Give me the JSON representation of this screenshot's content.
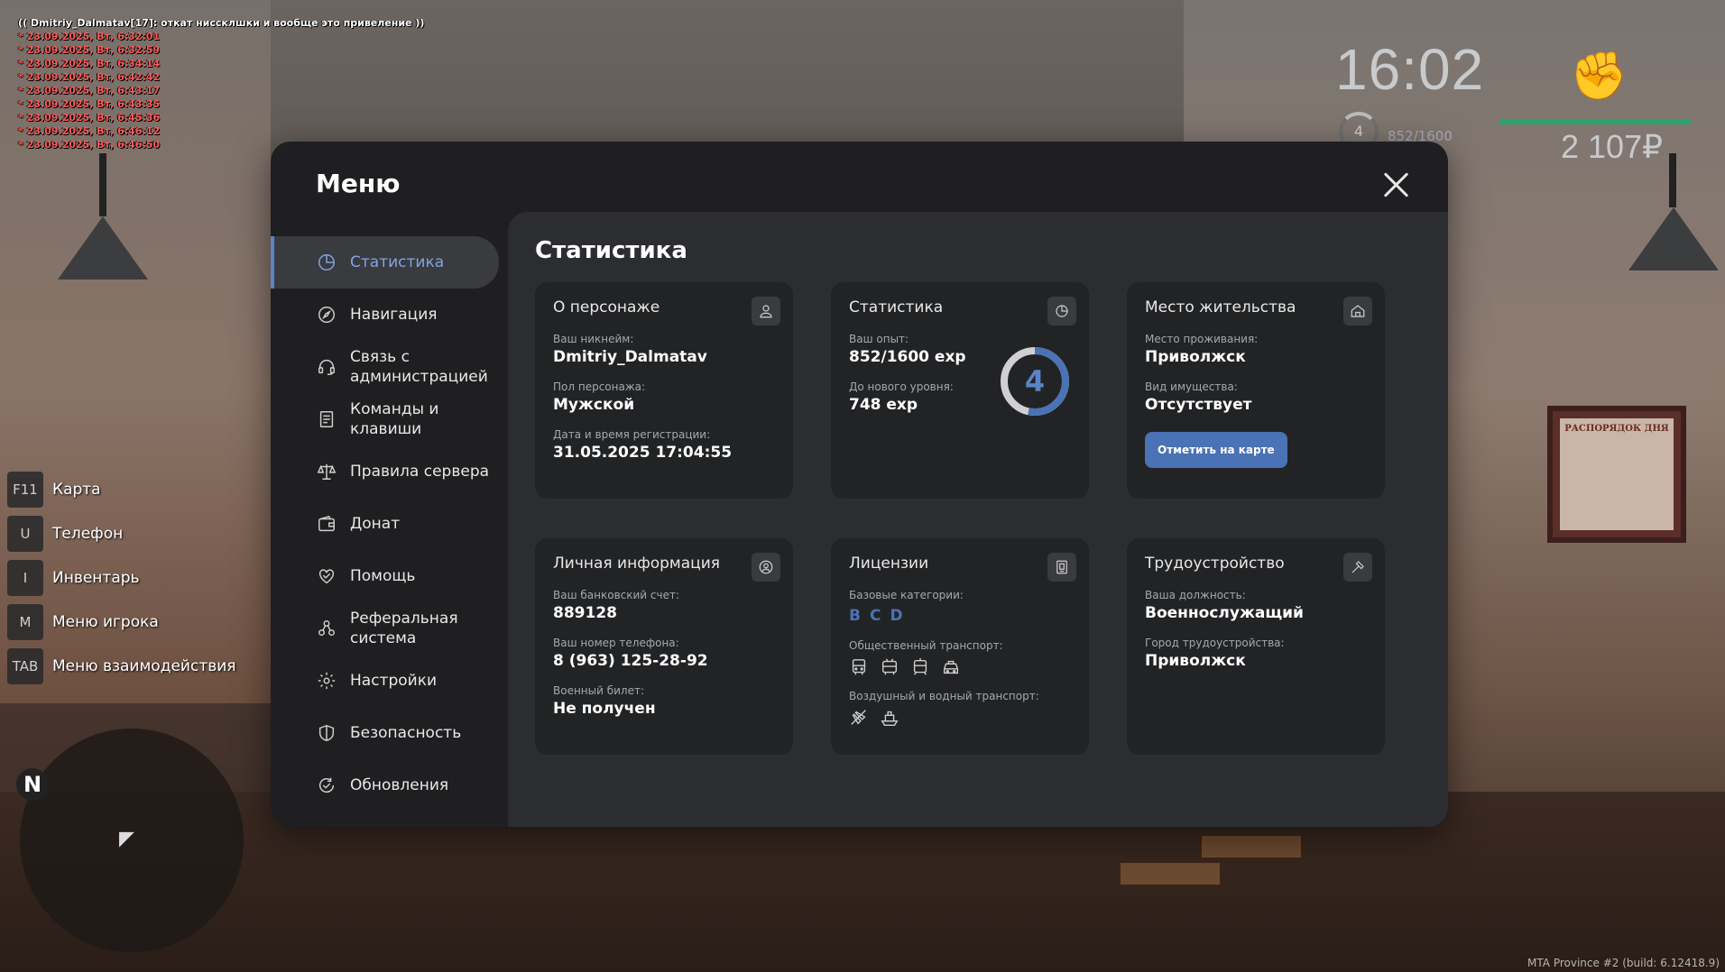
{
  "chat": {
    "header": "(( Dmitriy_Dalmatav[17]: откат ниссклшки и вообще это привеление ))",
    "lines": [
      "* 23.09.2025, Вт, 6:32:01",
      "* 23.09.2025, Вт, 6:32:59",
      "* 23.09.2025, Вт, 6:34:14",
      "* 23.09.2025, Вт, 6:42:42",
      "* 23.09.2025, Вт, 6:43:17",
      "* 23.09.2025, Вт, 6:43:35",
      "* 23.09.2025, Вт, 6:45:36",
      "* 23.09.2025, Вт, 6:46:12",
      "* 23.09.2025, Вт, 6:46:50"
    ]
  },
  "hud": {
    "time": "16:02",
    "level": "4",
    "exp": "852/1600",
    "money": "2 107₽",
    "health_fraction": 1.0,
    "weapon_icon": "fist-icon"
  },
  "quick_keys": [
    {
      "key": "F11",
      "label": "Карта"
    },
    {
      "key": "U",
      "label": "Телефон"
    },
    {
      "key": "I",
      "label": "Инвентарь"
    },
    {
      "key": "M",
      "label": "Меню игрока"
    },
    {
      "key": "TAB",
      "label": "Меню взаимодействия"
    }
  ],
  "minimap": {
    "north": "N"
  },
  "board_text": "РАСПОРЯДОК ДНЯ",
  "build": "MTA Province #2 (build: 6.12418.9)",
  "menu": {
    "title": "Меню",
    "sidebar": [
      {
        "label": "Статистика",
        "icon": "pie-chart-icon",
        "active": true
      },
      {
        "label": "Навигация",
        "icon": "compass-icon"
      },
      {
        "label": "Связь с администрацией",
        "icon": "headset-icon"
      },
      {
        "label": "Команды и клавиши",
        "icon": "document-icon"
      },
      {
        "label": "Правила сервера",
        "icon": "scales-icon"
      },
      {
        "label": "Донат",
        "icon": "wallet-icon"
      },
      {
        "label": "Помощь",
        "icon": "handshake-icon"
      },
      {
        "label": "Реферальная система",
        "icon": "referral-icon"
      },
      {
        "label": "Настройки",
        "icon": "gear-icon"
      },
      {
        "label": "Безопасность",
        "icon": "shield-icon"
      },
      {
        "label": "Обновления",
        "icon": "refresh-icon"
      }
    ],
    "content_title": "Статистика",
    "cards": {
      "character": {
        "title": "О персонаже",
        "nickname_label": "Ваш никнейм:",
        "nickname": "Dmitriy_Dalmatav",
        "gender_label": "Пол персонажа:",
        "gender": "Мужской",
        "reg_label": "Дата и время регистрации:",
        "reg": "31.05.2025 17:04:55"
      },
      "stats": {
        "title": "Статистика",
        "exp_label": "Ваш опыт:",
        "exp": "852/1600 exp",
        "next_label": "До нового уровня:",
        "next": "748 exp",
        "level": "4",
        "progress": 0.5325
      },
      "residence": {
        "title": "Место жительства",
        "place_label": "Место проживания:",
        "place": "Приволжск",
        "property_label": "Вид имущества:",
        "property": "Отсутствует",
        "map_button": "Отметить на карте"
      },
      "personal": {
        "title": "Личная информация",
        "bank_label": "Ваш банковский счет:",
        "bank": "889128",
        "phone_label": "Ваш номер телефона:",
        "phone": "8 (963) 125-28-92",
        "military_label": "Военный билет:",
        "military": "Не получен"
      },
      "licenses": {
        "title": "Лицензии",
        "base_label": "Базовые категории:",
        "base": [
          "B",
          "C",
          "D"
        ],
        "public_label": "Общественный транспорт:",
        "air_label": "Воздушный и водный транспорт:"
      },
      "job": {
        "title": "Трудоустройство",
        "position_label": "Ваша должность:",
        "position": "Военнослужащий",
        "city_label": "Город трудоустройства:",
        "city": "Приволжск"
      }
    }
  },
  "colors": {
    "accent": "#5a84c8",
    "button": "#4a73b5",
    "panel": "#1f1f21",
    "content": "#2c2d30",
    "card": "#222325"
  }
}
